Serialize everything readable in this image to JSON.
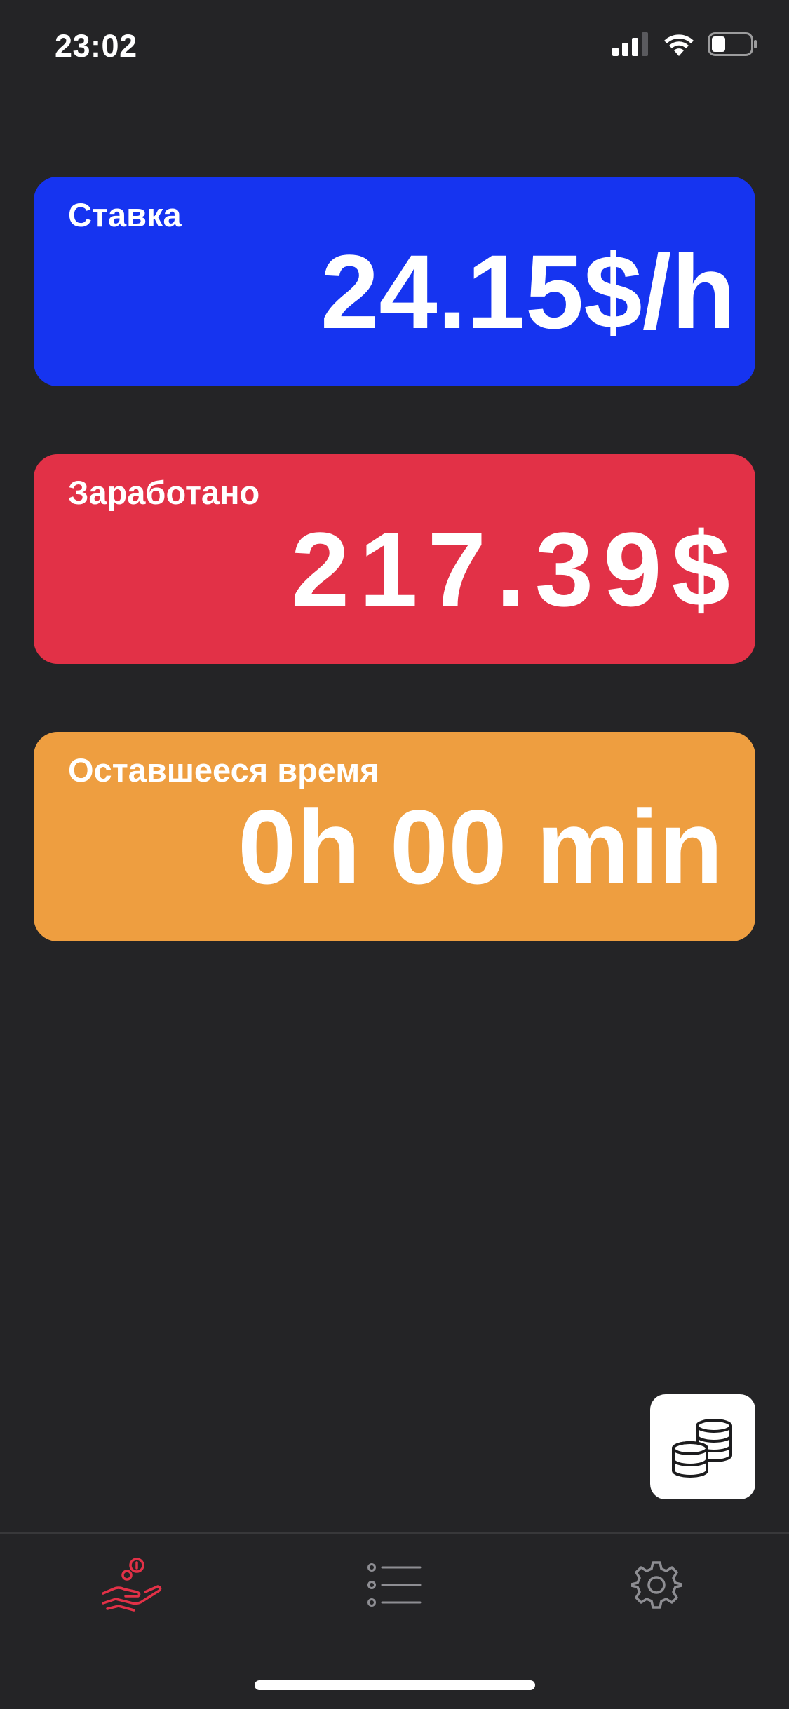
{
  "status_bar": {
    "time": "23:02",
    "battery_level": 0.35
  },
  "cards": [
    {
      "id": "rate",
      "label": "Ставка",
      "value": "24.15$/h",
      "color": "#1634F0"
    },
    {
      "id": "earned",
      "label": "Заработано",
      "value": "217.39$",
      "color": "#E23147"
    },
    {
      "id": "remaining",
      "label": "Оставшееся время",
      "value": "0h 00 min",
      "color": "#EE9E40"
    }
  ],
  "fab": {
    "icon": "coins-stack-icon"
  },
  "tab_bar": {
    "tabs": [
      {
        "icon": "hand-coins-icon",
        "active": true
      },
      {
        "icon": "list-icon",
        "active": false
      },
      {
        "icon": "gear-icon",
        "active": false
      }
    ],
    "active_color": "#E23147",
    "inactive_color": "#8E8E93"
  }
}
